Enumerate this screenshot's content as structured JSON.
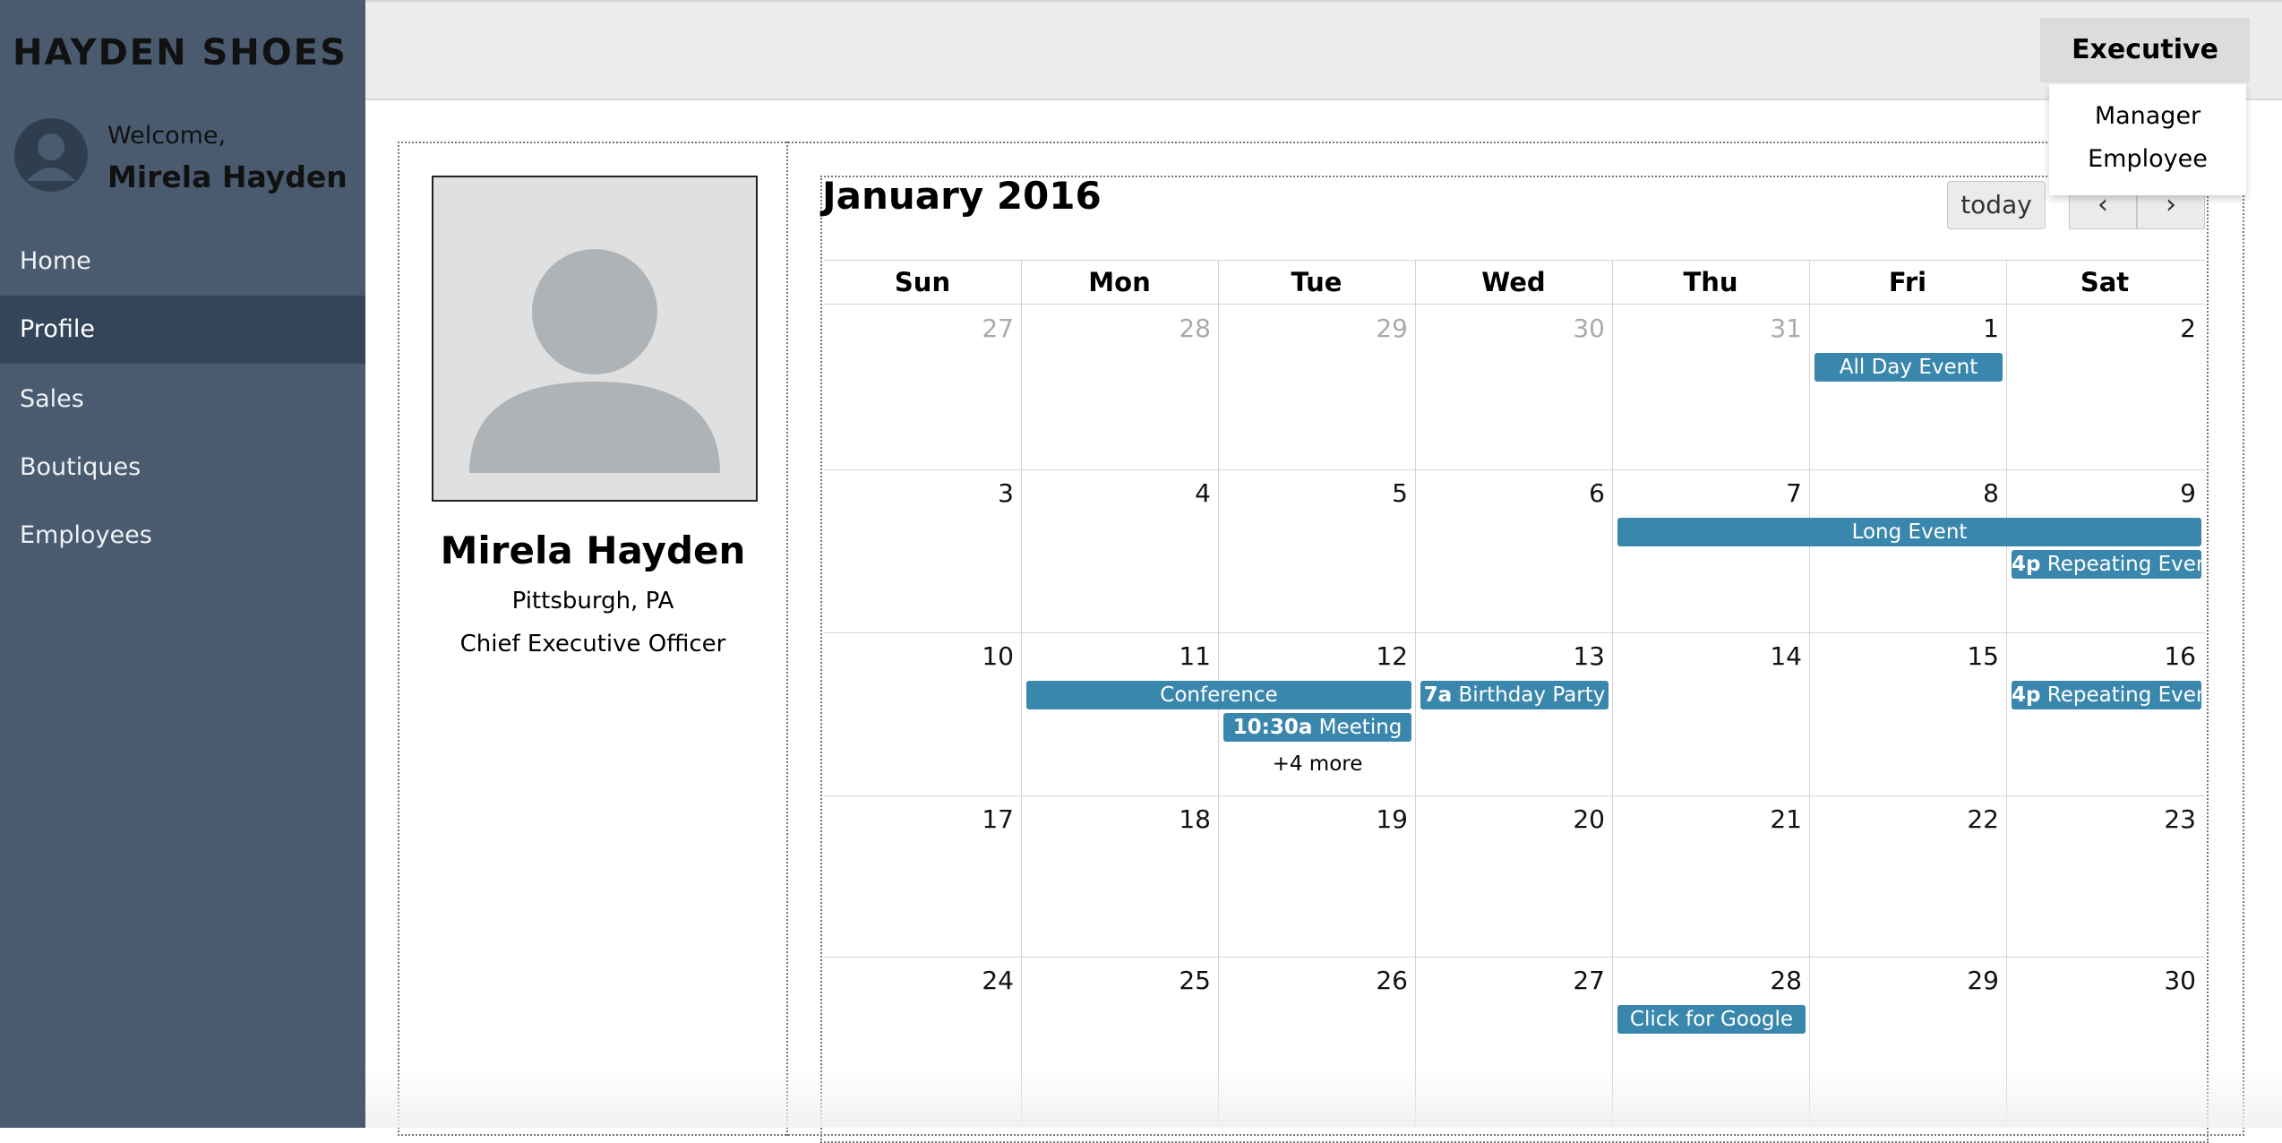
{
  "brand": "HAYDEN SHOES",
  "user": {
    "welcome": "Welcome,",
    "name": "Mirela Hayden"
  },
  "nav": [
    {
      "label": "Home",
      "active": false
    },
    {
      "label": "Profile",
      "active": true
    },
    {
      "label": "Sales",
      "active": false
    },
    {
      "label": "Boutiques",
      "active": false
    },
    {
      "label": "Employees",
      "active": false
    }
  ],
  "role_switch": {
    "selected": "Executive",
    "options": [
      "Manager",
      "Employee"
    ]
  },
  "profile": {
    "name": "Mirela Hayden",
    "location": "Pittsburgh, PA",
    "title": "Chief Executive Officer"
  },
  "calendar": {
    "title": "January 2016",
    "today_label": "today",
    "prev_icon": "‹",
    "next_icon": "›",
    "weekdays": [
      "Sun",
      "Mon",
      "Tue",
      "Wed",
      "Thu",
      "Fri",
      "Sat"
    ],
    "weeks": [
      [
        "27",
        "28",
        "29",
        "30",
        "31",
        "1",
        "2"
      ],
      [
        "3",
        "4",
        "5",
        "6",
        "7",
        "8",
        "9"
      ],
      [
        "10",
        "11",
        "12",
        "13",
        "14",
        "15",
        "16"
      ],
      [
        "17",
        "18",
        "19",
        "20",
        "21",
        "22",
        "23"
      ],
      [
        "24",
        "25",
        "26",
        "27",
        "28",
        "29",
        "30"
      ]
    ],
    "other_month_days_week0": 5,
    "events": [
      {
        "time": "",
        "title": "All Day Event"
      },
      {
        "time": "",
        "title": "Long Event"
      },
      {
        "time": "4p",
        "title": " Repeating Event"
      },
      {
        "time": "",
        "title": "Conference"
      },
      {
        "time": "10:30a",
        "title": " Meeting"
      },
      {
        "time": "7a",
        "title": " Birthday Party"
      },
      {
        "time": "4p",
        "title": " Repeating Event"
      },
      {
        "time": "",
        "title": "Click for Google"
      }
    ],
    "more_link": "+4 more"
  },
  "colors": {
    "sidebar": "#4a5b70",
    "sidebar_active": "#34455a",
    "event": "#3a87ad"
  }
}
